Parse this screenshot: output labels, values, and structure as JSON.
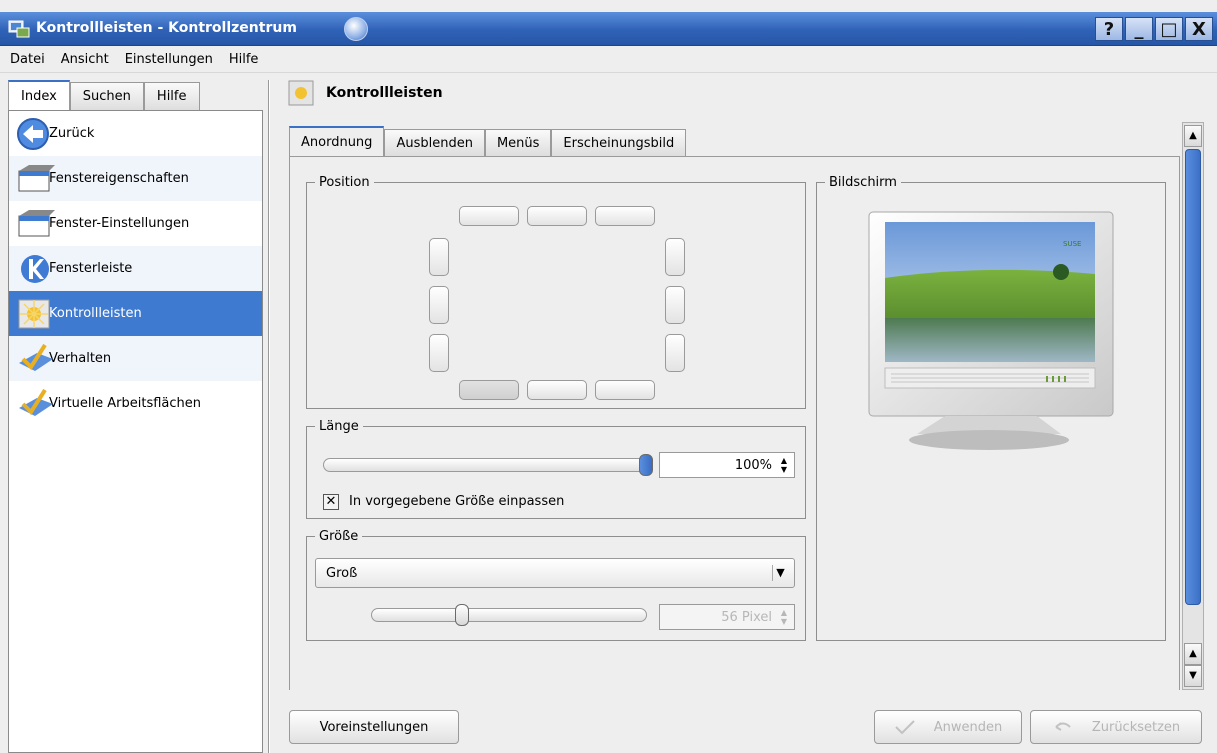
{
  "window": {
    "title": "Kontrollleisten - Kontrollzentrum",
    "buttons": {
      "help": "?",
      "minimize": "_",
      "maximize": "□",
      "close": "X"
    }
  },
  "menu": [
    "Datei",
    "Ansicht",
    "Einstellungen",
    "Hilfe"
  ],
  "left_tabs": [
    "Index",
    "Suchen",
    "Hilfe"
  ],
  "left_items": [
    {
      "label": "Zurück",
      "icon": "back-arrow-icon"
    },
    {
      "label": "Fenstereigenschaften",
      "icon": "window-icon"
    },
    {
      "label": "Fenster-Einstellungen",
      "icon": "window-icon"
    },
    {
      "label": "Fensterleiste",
      "icon": "kde-logo-icon"
    },
    {
      "label": "Kontrollleisten",
      "icon": "panel-icon",
      "selected": true
    },
    {
      "label": "Verhalten",
      "icon": "check-pencil-icon"
    },
    {
      "label": "Virtuelle Arbeitsflächen",
      "icon": "check-pencil-icon"
    }
  ],
  "page_title": "Kontrollleisten",
  "tabs": [
    "Anordnung",
    "Ausblenden",
    "Menüs",
    "Erscheinungsbild"
  ],
  "position": {
    "legend": "Position",
    "selected": "bottom-left"
  },
  "laenge": {
    "legend": "Länge",
    "value": "100%",
    "slider_fraction": 1.0,
    "checkbox_label": "In vorgegebene Größe einpassen",
    "checkbox_checked": true
  },
  "groesse": {
    "legend": "Größe",
    "combo_value": "Groß",
    "spin_value": "56 Pixel",
    "slider_fraction": 0.32
  },
  "bildschirm": {
    "legend": "Bildschirm",
    "monitor_badge": "SUSE"
  },
  "buttons": {
    "defaults": "Voreinstellungen",
    "apply": "Anwenden",
    "reset": "Zurücksetzen"
  }
}
